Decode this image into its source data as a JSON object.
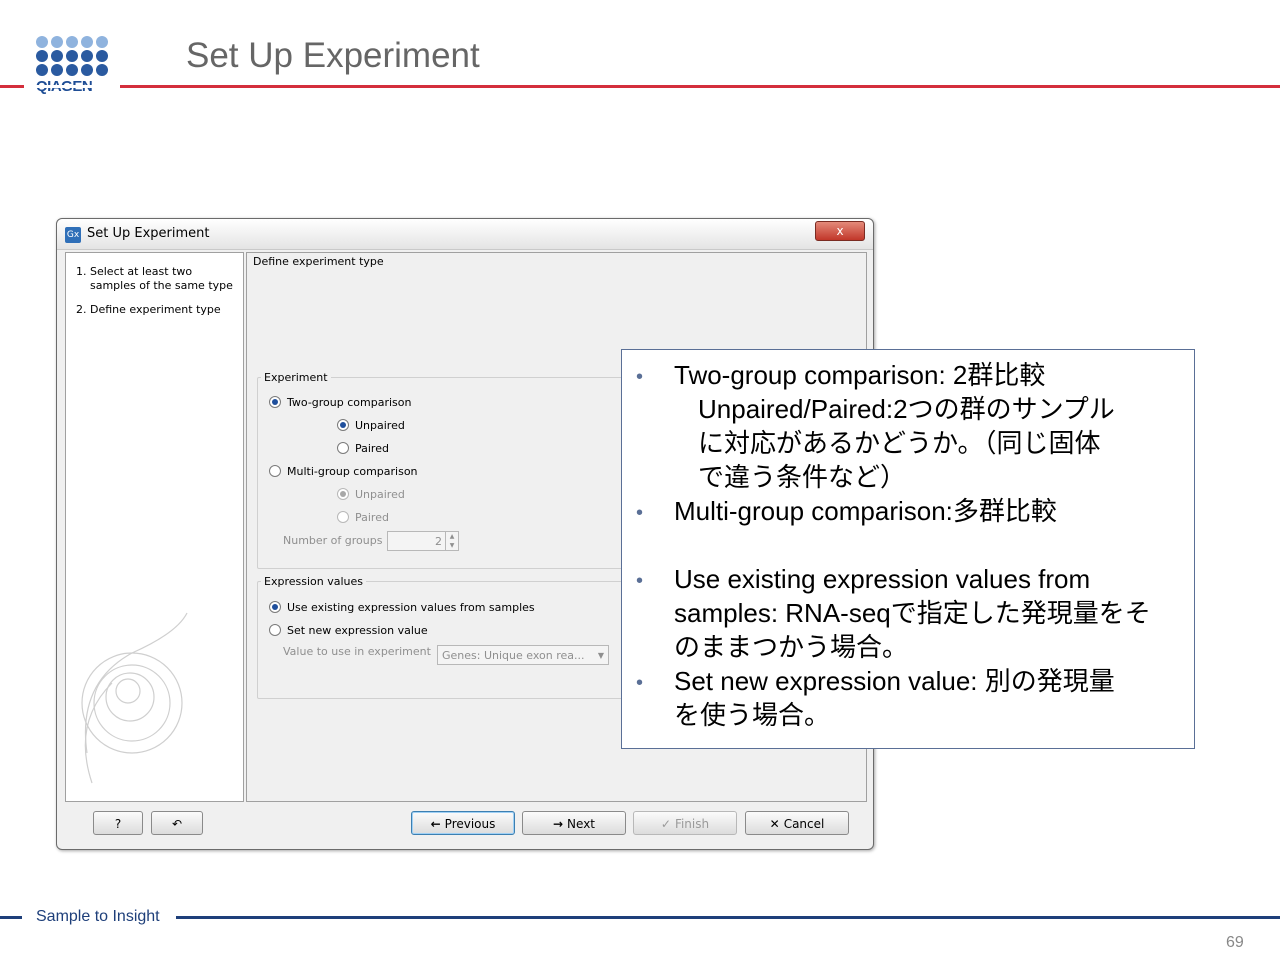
{
  "slide": {
    "title": "Set Up Experiment",
    "logo_text": "QIAGEN",
    "footer": "Sample to Insight",
    "page_number": "69",
    "colors": {
      "accent_red": "#d42e3c",
      "navy": "#1e3f7a",
      "logo_blue": "#2a5aa0"
    }
  },
  "dialog": {
    "title": "Set Up Experiment",
    "app_icon_text": "Gx",
    "close_glyph": "x",
    "steps": [
      {
        "num": "1.",
        "line1": "Select at least two",
        "line2": "samples of the same type"
      },
      {
        "num": "2.",
        "line1": "Define experiment type"
      }
    ],
    "pane_heading": "Define experiment type",
    "experiment": {
      "label": "Experiment",
      "two_group": "Two-group comparison",
      "unpaired": "Unpaired",
      "paired": "Paired",
      "multi_group": "Multi-group comparison",
      "multi_unpaired": "Unpaired",
      "multi_paired": "Paired",
      "num_groups_label": "Number of groups",
      "num_groups_value": "2"
    },
    "expression": {
      "label": "Expression values",
      "use_existing": "Use existing expression values from samples",
      "set_new": "Set new expression value",
      "value_label": "Value to use in experiment",
      "value_selected": "Genes: Unique exon rea..."
    },
    "buttons": {
      "help": "?",
      "reset_icon": "↶",
      "previous": "Previous",
      "next": "Next",
      "finish": "Finish",
      "cancel": "Cancel"
    },
    "selection": {
      "experiment": "Two-group comparison",
      "pairing": "Unpaired",
      "expression": "Use existing expression values from samples"
    }
  },
  "callout": {
    "lines": [
      "Two-group comparison: 2群比較",
      "Unpaired/Paired:2つの群のサンプル",
      "に対応があるかどうか。（同じ固体",
      "で違う条件など）",
      "Multi-group comparison:多群比較",
      "Use existing expression values from",
      "samples: RNA-seqで指定した発現量をそ",
      "のままつかう場合。",
      "Set new expression value:  別の発現量",
      "を使う場合。"
    ],
    "bullet": "•"
  }
}
